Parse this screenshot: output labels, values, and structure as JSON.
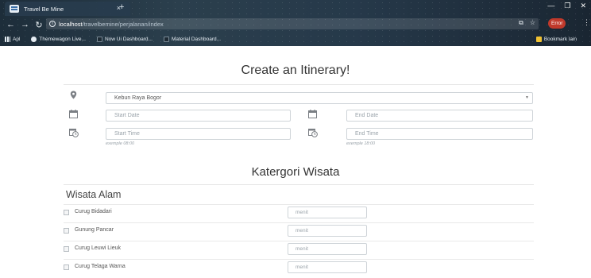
{
  "browser": {
    "tab_title": "Travel Be Mine",
    "tab_close": "×",
    "new_tab": "+",
    "url_host": "localhost",
    "url_path": "/travelbemine/perjalanan/index",
    "error_label": "Error",
    "bookmarks": {
      "apps": "Apl",
      "themewagon": "Themewagon Live...",
      "now_ui": "Now Ui Dashboard...",
      "material": "Material Dashboard...",
      "other": "Bookmark lain"
    }
  },
  "form": {
    "title": "Create an Itinerary!",
    "location_value": "Kebun Raya Bogor",
    "start_date_placeholder": "Start Date",
    "end_date_placeholder": "End Date",
    "start_time_placeholder": "Start Time",
    "end_time_placeholder": "End Time",
    "start_time_hint": "exemple 08:00",
    "end_time_hint": "exemple 18:00"
  },
  "category": {
    "title": "Katergori Wisata",
    "section": "Wisata Alam",
    "minute_placeholder": "menit",
    "items": [
      {
        "label": "Curug Bidadari"
      },
      {
        "label": "Gunung Pancar"
      },
      {
        "label": "Curug Leuwi Lieuk"
      },
      {
        "label": "Curug Telaga Warna"
      }
    ]
  },
  "icons": {
    "location": "map-marker-icon",
    "calendar": "calendar-icon",
    "clock_calendar": "calendar-clock-icon"
  }
}
